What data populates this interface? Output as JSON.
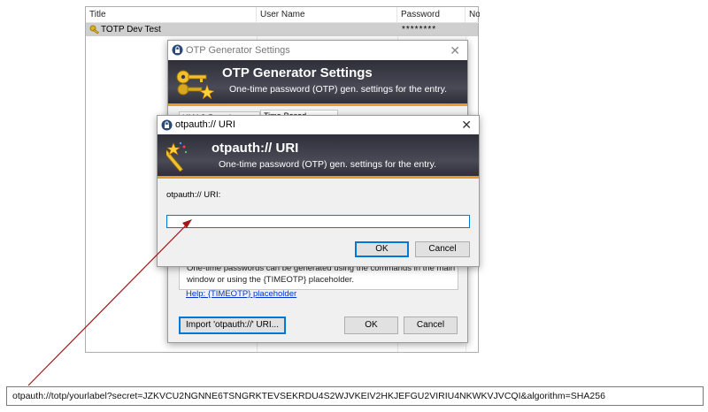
{
  "table": {
    "columns": [
      "Title",
      "User Name",
      "Password",
      "Notes"
    ],
    "rows": [
      {
        "title": "TOTP Dev Test",
        "user": "",
        "password": "********",
        "notes": ""
      }
    ]
  },
  "otp_settings": {
    "window_title": "OTP Generator Settings",
    "banner_title": "OTP Generator Settings",
    "banner_subtitle": "One-time password (OTP) gen. settings for the entry.",
    "tabs": [
      "HMAC-Based (HOTP)",
      "Time-Based (TOTP)"
    ],
    "info_text_1": "One-time passwords can be generated using the commands in the main",
    "info_text_2": "window or using the {TIMEOTP} placeholder.",
    "help_link": "Help: {TIMEOTP} placeholder",
    "import_button": "Import 'otpauth://' URI...",
    "ok_button": "OK",
    "cancel_button": "Cancel"
  },
  "uri_dialog": {
    "window_title": "otpauth:// URI",
    "banner_title": "otpauth:// URI",
    "banner_subtitle": "One-time password (OTP) gen. settings for the entry.",
    "field_label": "otpauth:// URI:",
    "field_value": "",
    "ok_button": "OK",
    "cancel_button": "Cancel"
  },
  "annotation": {
    "uri_text": "otpauth://totp/yourlabel?secret=JZKVCU2NGNNE6TSNGRKTEVSEKRDU4S2WJVKEIV2HKJEFGU2VIRIU4NKWKVJVCQI&algorithm=SHA256",
    "arrow_color": "#a01818"
  },
  "colors": {
    "banner_dark": "#3a3a44",
    "banner_stripe": "#e89a2c",
    "selected_row": "#cfcfcf",
    "default_button_border": "#0078d7",
    "link": "#0033cc"
  },
  "icons": {
    "entry_icon": "key-icon",
    "window_icon": "lock-icon",
    "otp_banner_icon": "keys-with-star-icon",
    "uri_banner_icon": "magic-wand-icon"
  }
}
